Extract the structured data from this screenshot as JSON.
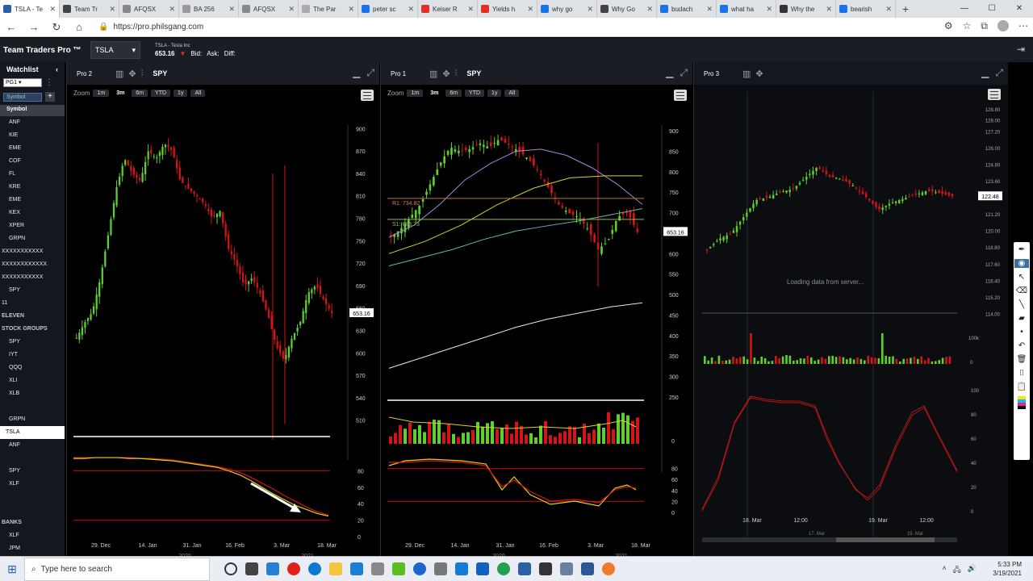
{
  "browser": {
    "tabs": [
      {
        "title": "TSLA - Te",
        "icon": "chart-icon",
        "color": "#2a5ea8"
      },
      {
        "title": "Team Tr",
        "icon": "globe-icon",
        "color": "#444"
      },
      {
        "title": "AFQSX",
        "icon": "fund-icon",
        "color": "#888"
      },
      {
        "title": "BA 256",
        "icon": "doc-icon",
        "color": "#999"
      },
      {
        "title": "AFQSX",
        "icon": "fund-icon",
        "color": "#888"
      },
      {
        "title": "The Par",
        "icon": "doc-icon",
        "color": "#aaa"
      },
      {
        "title": "peter sc",
        "icon": "bing-icon",
        "color": "#1b73e8"
      },
      {
        "title": "Keiser R",
        "icon": "youtube-icon",
        "color": "#e52d27"
      },
      {
        "title": "Yields h",
        "icon": "youtube-icon",
        "color": "#e52d27"
      },
      {
        "title": "why go",
        "icon": "bing-icon",
        "color": "#1b73e8"
      },
      {
        "title": "Why Go",
        "icon": "news-icon",
        "color": "#444"
      },
      {
        "title": "budach",
        "icon": "bing-icon",
        "color": "#1b73e8"
      },
      {
        "title": "what ha",
        "icon": "bing-icon",
        "color": "#1b73e8"
      },
      {
        "title": "Why the",
        "icon": "globe-icon",
        "color": "#333"
      },
      {
        "title": "bearish",
        "icon": "bing-icon",
        "color": "#1b73e8"
      }
    ],
    "url": "https://pro.philsgang.com"
  },
  "app": {
    "brand": "Team Traders Pro ™",
    "symbol": "TSLA",
    "quote_name": "TSLA - Tesla Inc",
    "last": "653.16",
    "bid_label": "Bid:",
    "ask_label": "Ask:",
    "diff_label": "Diff:"
  },
  "watchlist": {
    "title": "Watchlist",
    "list_name": "PG1",
    "symbol_placeholder": "Symbol",
    "column": "Symbol",
    "items": [
      {
        "label": "ANF",
        "kind": "item"
      },
      {
        "label": "KIE",
        "kind": "item"
      },
      {
        "label": "EME",
        "kind": "item"
      },
      {
        "label": "COF",
        "kind": "item"
      },
      {
        "label": "FL",
        "kind": "item"
      },
      {
        "label": "KRE",
        "kind": "item"
      },
      {
        "label": "EME",
        "kind": "item"
      },
      {
        "label": "KEX",
        "kind": "item"
      },
      {
        "label": "XPER",
        "kind": "item"
      },
      {
        "label": "GRPN",
        "kind": "item"
      },
      {
        "label": "XXXXXXXXXXX",
        "kind": "flat"
      },
      {
        "label": "XXXXXXXXXXXX",
        "kind": "flat"
      },
      {
        "label": "XXXXXXXXXXX",
        "kind": "flat"
      },
      {
        "label": "SPY",
        "kind": "item"
      },
      {
        "label": "11",
        "kind": "flat"
      },
      {
        "label": "ELEVEN",
        "kind": "group"
      },
      {
        "label": "STOCK GROUPS",
        "kind": "group"
      },
      {
        "label": "SPY",
        "kind": "item"
      },
      {
        "label": "IYT",
        "kind": "item"
      },
      {
        "label": "QQQ",
        "kind": "item"
      },
      {
        "label": "XLI",
        "kind": "item"
      },
      {
        "label": "XLB",
        "kind": "item"
      },
      {
        "label": "",
        "kind": "item"
      },
      {
        "label": "GRPN",
        "kind": "item"
      },
      {
        "label": "TSLA",
        "kind": "sel"
      },
      {
        "label": "ANF",
        "kind": "item"
      },
      {
        "label": "",
        "kind": "item"
      },
      {
        "label": "SPY",
        "kind": "item"
      },
      {
        "label": "XLF",
        "kind": "item"
      },
      {
        "label": "",
        "kind": "item"
      },
      {
        "label": "",
        "kind": "item"
      },
      {
        "label": "BANKS",
        "kind": "group"
      },
      {
        "label": "XLF",
        "kind": "item"
      },
      {
        "label": "JPM",
        "kind": "item"
      }
    ]
  },
  "panels": {
    "pro2": {
      "title": "Pro 2",
      "symbol": "SPY",
      "zoom_label": "Zoom",
      "zoom_buttons": [
        "1m",
        "3m",
        "6m",
        "YTD",
        "1y",
        "All"
      ],
      "zoom_active": "3m",
      "price_tag": "653.16"
    },
    "pro1": {
      "title": "Pro 1",
      "symbol": "SPY",
      "zoom_label": "Zoom",
      "zoom_buttons": [
        "1m",
        "3m",
        "6m",
        "YTD",
        "1y",
        "All"
      ],
      "zoom_active": "3m",
      "price_tag": "653.16",
      "r1_label": "R1: 734.82",
      "s1_label": "S1: 683.73"
    },
    "pro3": {
      "title": "Pro 3",
      "loading": "Loading data from server...",
      "price_tag": "122.48"
    }
  },
  "chart_data": [
    {
      "type": "candlestick",
      "name": "Pro 2 - TSLA daily",
      "x_ticks": [
        "29. Dec",
        "14. Jan",
        "31. Jan",
        "16. Feb",
        "3. Mar",
        "18. Mar"
      ],
      "years": [
        "2020",
        "2021"
      ],
      "y_ticks": [
        900,
        870,
        840,
        810,
        780,
        750,
        720,
        690,
        660,
        630,
        600,
        570,
        540,
        510
      ],
      "ylim": [
        500,
        910
      ],
      "close": [
        620,
        640,
        655,
        700,
        760,
        820,
        860,
        840,
        830,
        870,
        860,
        880,
        870,
        830,
        820,
        810,
        800,
        780,
        790,
        740,
        720,
        690,
        700,
        680,
        650,
        610,
        590,
        620,
        640,
        680,
        690,
        670,
        653
      ],
      "osc_y_ticks": [
        80,
        60,
        40,
        20,
        0
      ],
      "osc_fast": [
        95,
        95,
        96,
        96,
        96,
        95,
        95,
        94,
        93,
        92,
        90,
        88,
        86,
        84,
        80,
        75,
        68,
        60,
        52,
        45,
        38,
        33,
        28,
        25
      ],
      "osc_slow": [
        96,
        96,
        96,
        96,
        96,
        96,
        95,
        95,
        94,
        93,
        91,
        89,
        87,
        85,
        82,
        78,
        72,
        65,
        58,
        50,
        43,
        36,
        30,
        26
      ]
    },
    {
      "type": "candlestick",
      "name": "Pro 1 - TSLA weekly",
      "x_ticks": [
        "29. Dec",
        "14. Jan",
        "31. Jan",
        "16. Feb",
        "3. Mar",
        "18. Mar"
      ],
      "years": [
        "2020",
        "2021"
      ],
      "y_ticks": [
        900,
        850,
        800,
        750,
        700,
        650,
        600,
        550,
        500,
        450,
        400,
        350,
        300,
        250
      ],
      "ylim": [
        240,
        910
      ],
      "close": [
        640,
        660,
        690,
        720,
        770,
        820,
        860,
        850,
        855,
        870,
        860,
        880,
        865,
        850,
        830,
        800,
        760,
        720,
        700,
        690,
        660,
        610,
        630,
        690,
        700,
        653
      ],
      "vol_y_ticks": [
        0
      ],
      "osc_y_ticks": [
        80,
        60,
        40,
        20,
        0
      ],
      "r1": 734.82,
      "s1": 683.73
    },
    {
      "type": "candlestick",
      "name": "Pro 3 - intraday",
      "x_ticks": [
        "18. Mar",
        "12:00",
        "19. Mar",
        "12:00"
      ],
      "nav_ticks": [
        "17. Mar",
        "19. Mar"
      ],
      "y_ticks": [
        128.8,
        128,
        127.2,
        126,
        124.8,
        123.6,
        122.4,
        121.2,
        120,
        118.8,
        117.6,
        116.4,
        115.2,
        114
      ],
      "ylim": [
        113.5,
        129.5
      ],
      "last": 122.48,
      "vol_y_ticks": [
        "100k",
        "0"
      ],
      "osc_y_ticks": [
        100,
        80,
        60,
        40,
        20,
        0
      ]
    }
  ],
  "taskbar": {
    "search_placeholder": "Type here to search",
    "time": "5:33 PM",
    "date": "3/19/2021"
  }
}
